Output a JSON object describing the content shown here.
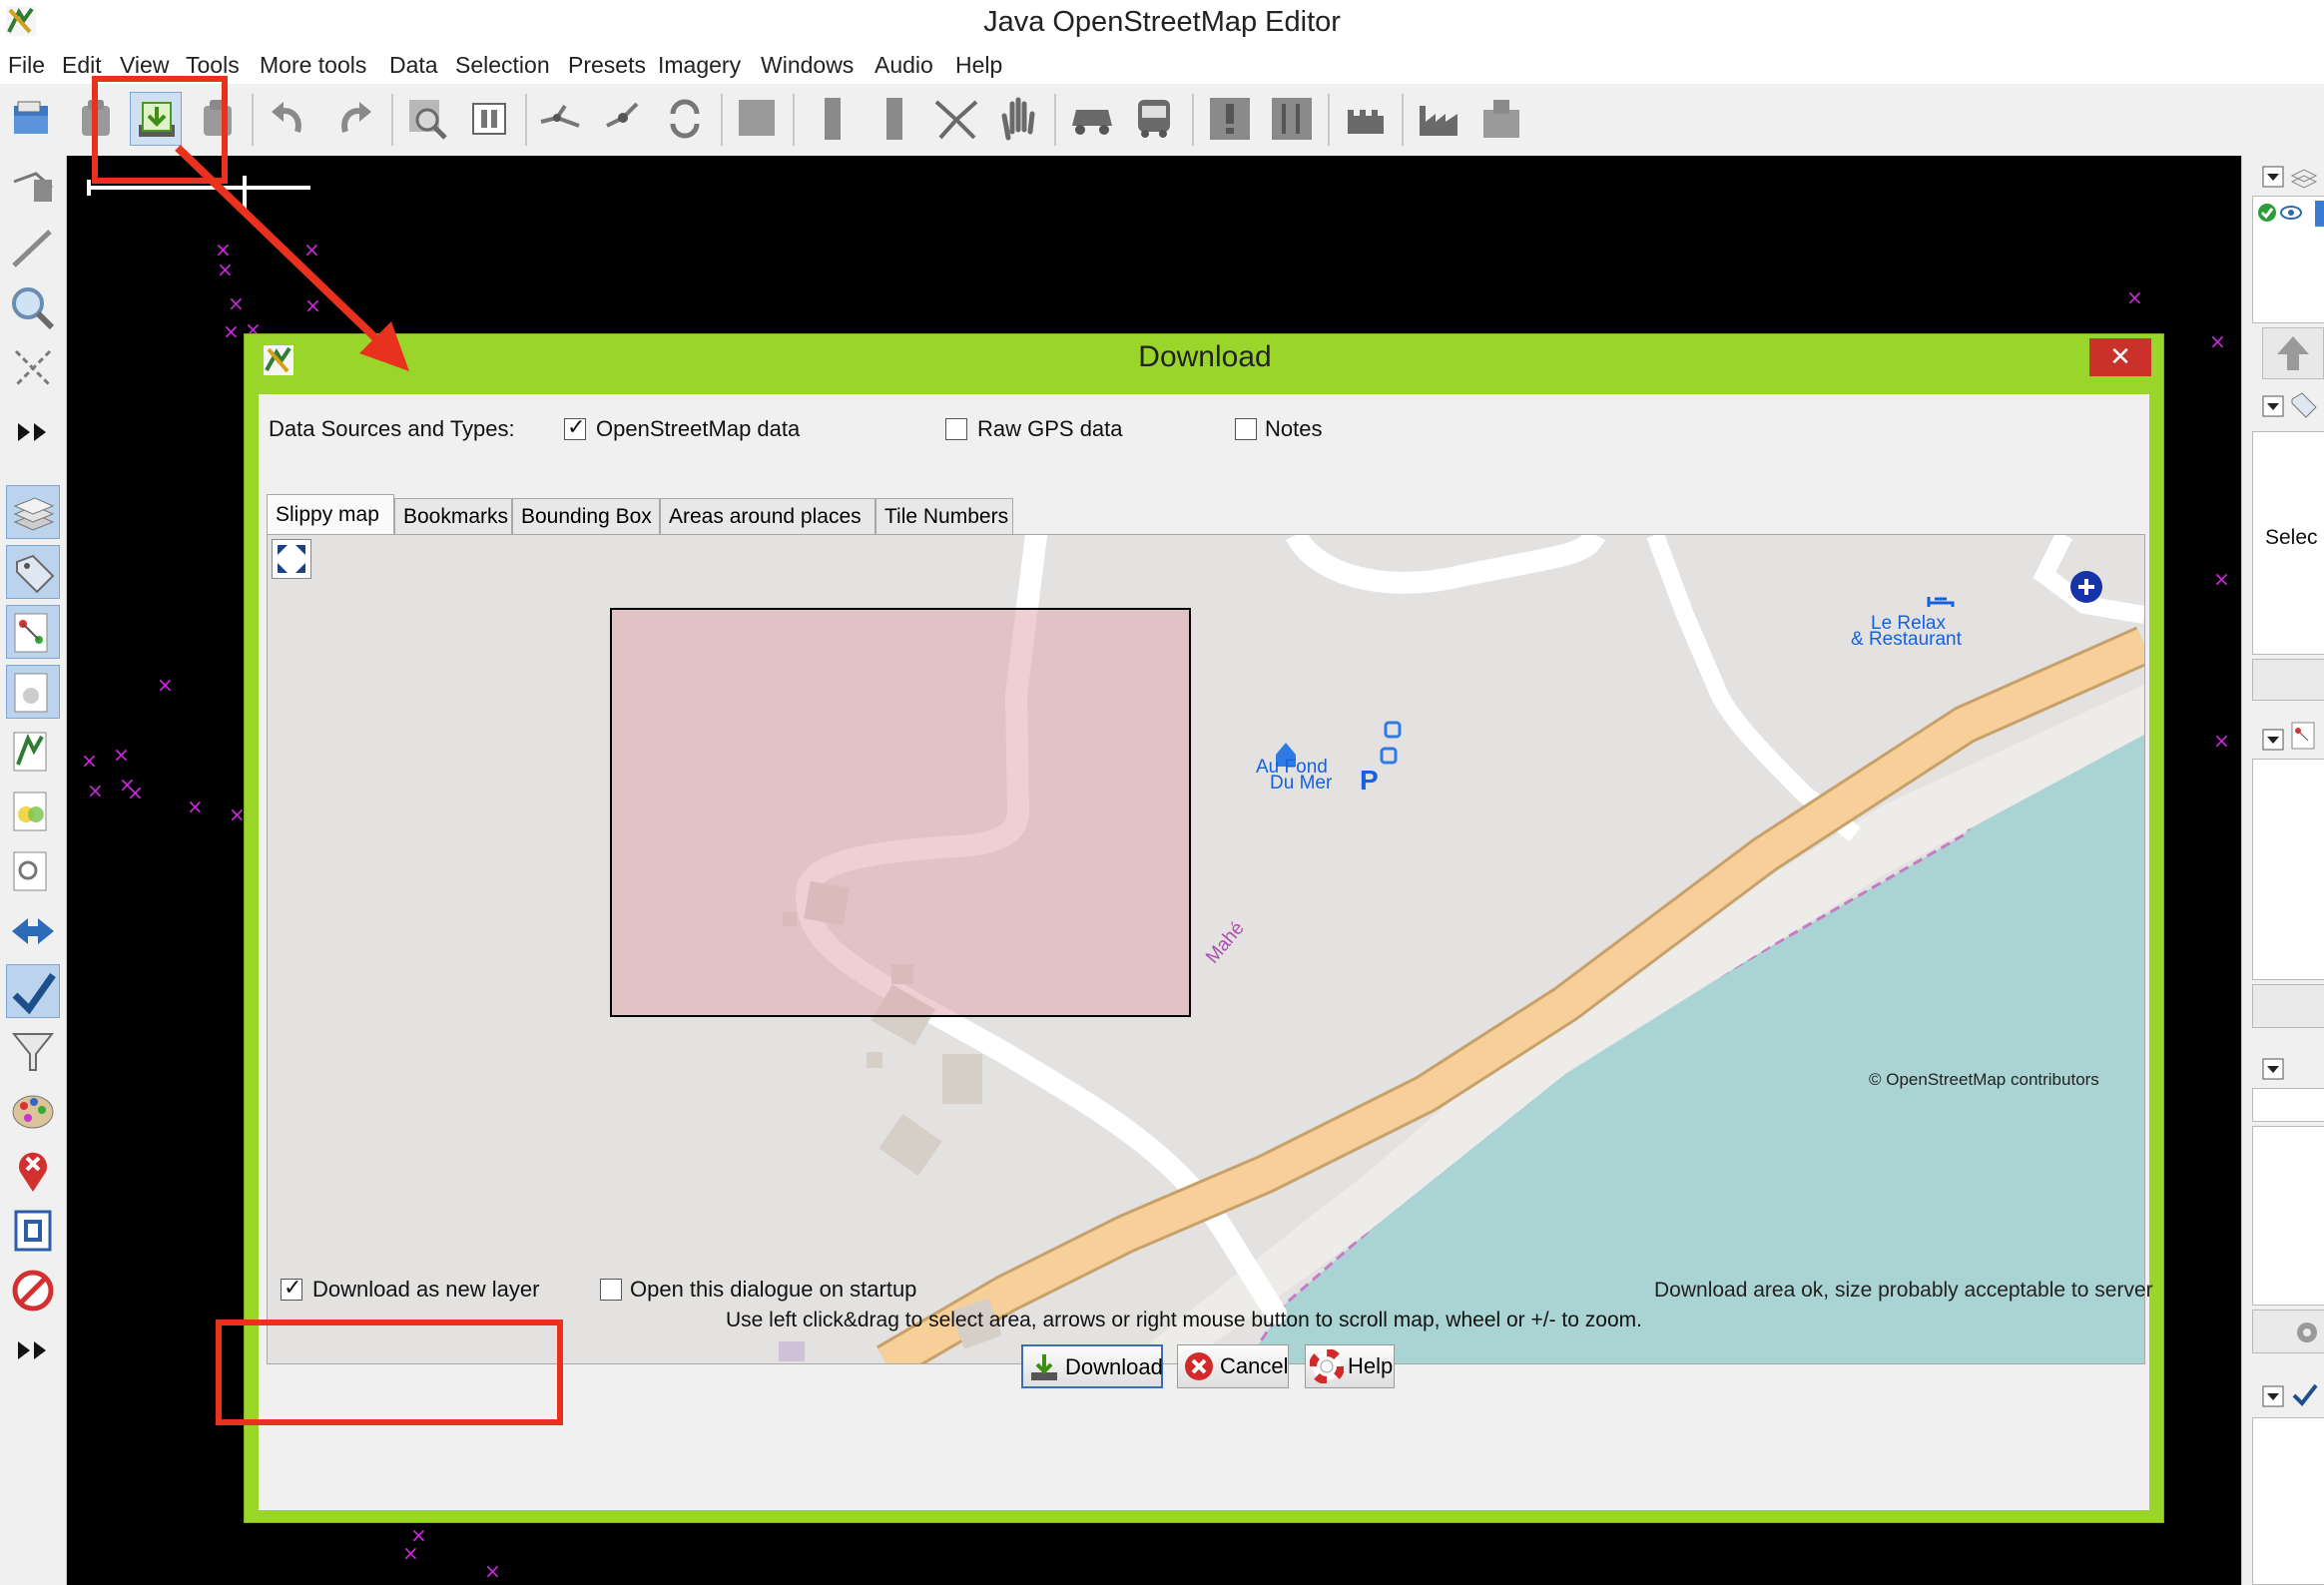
{
  "window": {
    "title": "Java OpenStreetMap Editor"
  },
  "menu": [
    "File",
    "Edit",
    "View",
    "Tools",
    "More tools",
    "Data",
    "Selection",
    "Presets",
    "Imagery",
    "Windows",
    "Audio",
    "Help"
  ],
  "dialog": {
    "title": "Download",
    "close_label": "✕",
    "sources_label": "Data Sources and Types:",
    "sources": [
      {
        "label": "OpenStreetMap data",
        "checked": true
      },
      {
        "label": "Raw GPS data",
        "checked": false
      },
      {
        "label": "Notes",
        "checked": false
      }
    ],
    "tabs": [
      "Slippy map",
      "Bookmarks",
      "Bounding Box",
      "Areas around places",
      "Tile Numbers"
    ],
    "active_tab": "Slippy map",
    "map": {
      "poi_hotel": "Le Relax\n& Restaurant",
      "poi_hotel_line1": "Le Relax",
      "poi_hotel_line2": "& Restaurant",
      "poi_house_line1": "Au Fond",
      "poi_house_line2": "Du Mer",
      "parking": "P",
      "coast_label": "Mahé",
      "attribution": "© OpenStreetMap contributors"
    },
    "options": {
      "new_layer_label": "Download as new layer",
      "new_layer_checked": true,
      "startup_label": "Open this dialogue on startup",
      "startup_checked": false
    },
    "status": "Download area ok, size probably acceptable to server",
    "hint": "Use left click&drag to select area, arrows or right mouse button to scroll map, wheel or +/- to zoom.",
    "buttons": {
      "download": "Download",
      "cancel": "Cancel",
      "help": "Help"
    }
  },
  "right_panel": {
    "select_label": "Selec"
  },
  "colors": {
    "dialog_frame": "#9ad52a",
    "highlight": "#e8321e",
    "selection_fill": "#e4b8bc",
    "water": "#aad3d4",
    "road": "#f7cf98"
  }
}
